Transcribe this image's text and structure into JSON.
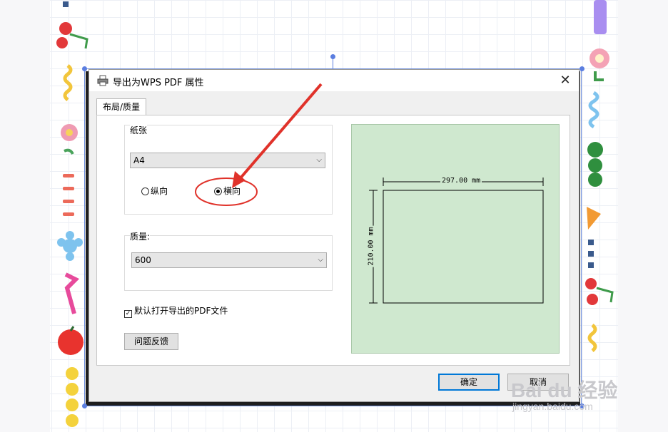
{
  "dialog": {
    "title": "导出为WPS PDF 属性",
    "close_label": "✕"
  },
  "tabs": [
    {
      "label": "布局/质量"
    }
  ],
  "paper": {
    "group_label": "纸张",
    "size_value": "A4",
    "orientation_options": [
      {
        "label": "纵向",
        "selected": false
      },
      {
        "label": "横向",
        "selected": true
      }
    ]
  },
  "quality": {
    "group_label": "质量:",
    "value": "600"
  },
  "options": {
    "open_after_export_label": "默认打开导出的PDF文件",
    "open_after_export_checked": true
  },
  "feedback_button": "问题反馈",
  "preview": {
    "width_label": "297.00 mm",
    "height_label": "210.00 mm"
  },
  "footer": {
    "ok_label": "确定",
    "cancel_label": "取消"
  },
  "watermark": {
    "brand": "Bai du 经验",
    "url": "jingyan.baidu.com"
  },
  "colors": {
    "annotation_red": "#e0322a",
    "preview_green": "#cfe8cf",
    "selection_blue": "#5b7ee0"
  }
}
